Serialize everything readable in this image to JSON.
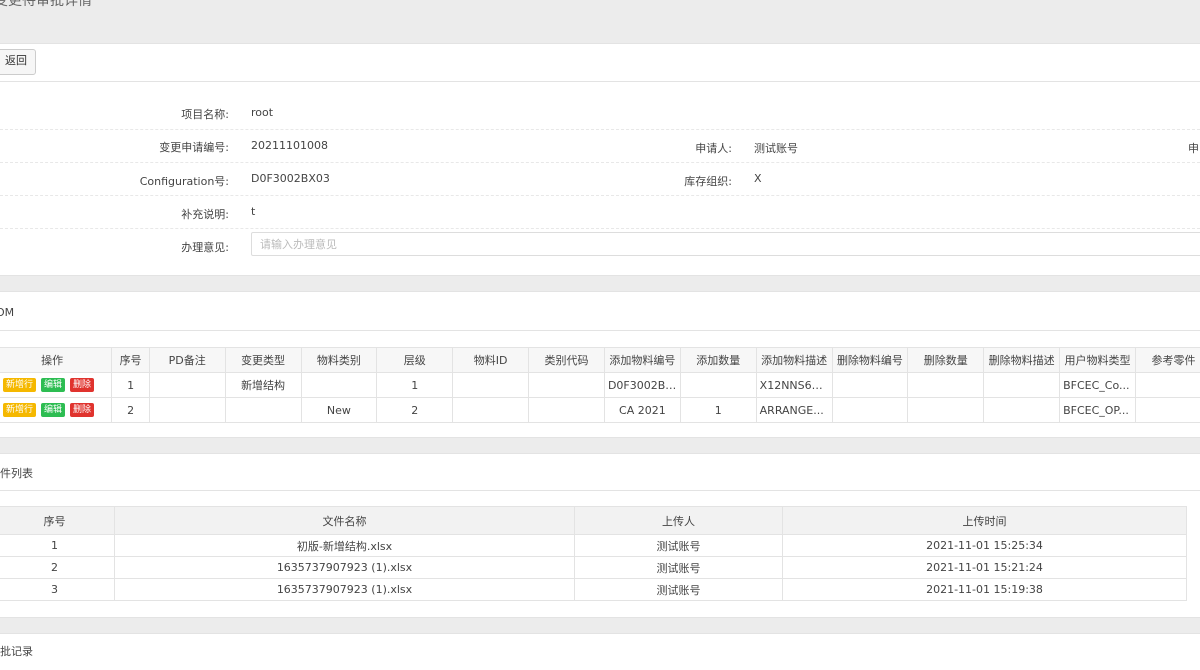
{
  "page": {
    "title": "变更待审批详情"
  },
  "toolbar": {
    "back_label": "返回"
  },
  "form": {
    "project_name_label": "项目名称:",
    "project_name_value": "root",
    "request_no_label": "变更申请编号:",
    "request_no_value": "20211101008",
    "applicant_label": "申请人:",
    "applicant_value": "测试账号",
    "right_cut_label": "申",
    "config_label": "Configuration号:",
    "config_value": "D0F3002BX03",
    "stock_org_label": "库存组织:",
    "stock_org_value": "X",
    "supplement_label": "补充说明:",
    "supplement_value": "t",
    "opinion_label": "办理意见:",
    "opinion_placeholder": "请输入办理意见"
  },
  "bom": {
    "title": "OM",
    "columns": [
      "操作",
      "序号",
      "PD备注",
      "变更类型",
      "物料类别",
      "层级",
      "物料ID",
      "类别代码",
      "添加物料编号",
      "添加数量",
      "添加物料描述",
      "删除物料编号",
      "删除数量",
      "删除物料描述",
      "用户物料类型",
      "参考零件"
    ],
    "actions": {
      "add": "新增行",
      "edit": "编辑",
      "del": "删除"
    },
    "rows": [
      [
        "1",
        "",
        "新增结构",
        "",
        "1",
        "",
        "",
        "D0F3002BX...",
        "",
        "X12NNS6B...",
        "",
        "",
        "",
        "BFCEC_Co...",
        ""
      ],
      [
        "2",
        "",
        "",
        "New",
        "2",
        "",
        "",
        "CA 2021",
        "1",
        "ARRANGE...",
        "",
        "",
        "",
        "BFCEC_OP...",
        ""
      ]
    ]
  },
  "files": {
    "title": "件列表",
    "columns": [
      "序号",
      "文件名称",
      "上传人",
      "上传时间"
    ],
    "rows": [
      [
        "1",
        "初版-新增结构.xlsx",
        "测试账号",
        "2021-11-01 15:25:34"
      ],
      [
        "2",
        "1635737907923 (1).xlsx",
        "测试账号",
        "2021-11-01 15:21:24"
      ],
      [
        "3",
        "1635737907923 (1).xlsx",
        "测试账号",
        "2021-11-01 15:19:38"
      ]
    ]
  },
  "approval": {
    "title": "批记录"
  }
}
